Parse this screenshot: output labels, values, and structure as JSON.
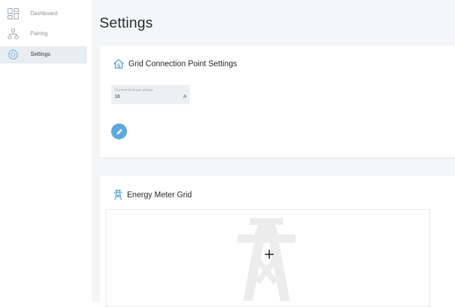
{
  "sidebar": {
    "items": [
      {
        "label": "Dashboard",
        "icon": "dashboard-icon",
        "active": false
      },
      {
        "label": "Pairing",
        "icon": "pairing-icon",
        "active": false
      },
      {
        "label": "Settings",
        "icon": "gear-icon",
        "active": true
      }
    ]
  },
  "main": {
    "title": "Settings",
    "grid_card": {
      "title": "Grid Connection Point Settings",
      "icon": "house-grid-icon",
      "field": {
        "label": "Current limit per phase",
        "value": "16",
        "unit": "A"
      },
      "edit_icon": "pencil-icon"
    },
    "meter_card": {
      "title": "Energy Meter Grid",
      "icon": "power-tower-icon",
      "add_label": "+"
    }
  },
  "colors": {
    "accent": "#5fa8dd",
    "sidebar_active_bg": "#e8edf2",
    "main_bg": "#f3f5f7"
  }
}
